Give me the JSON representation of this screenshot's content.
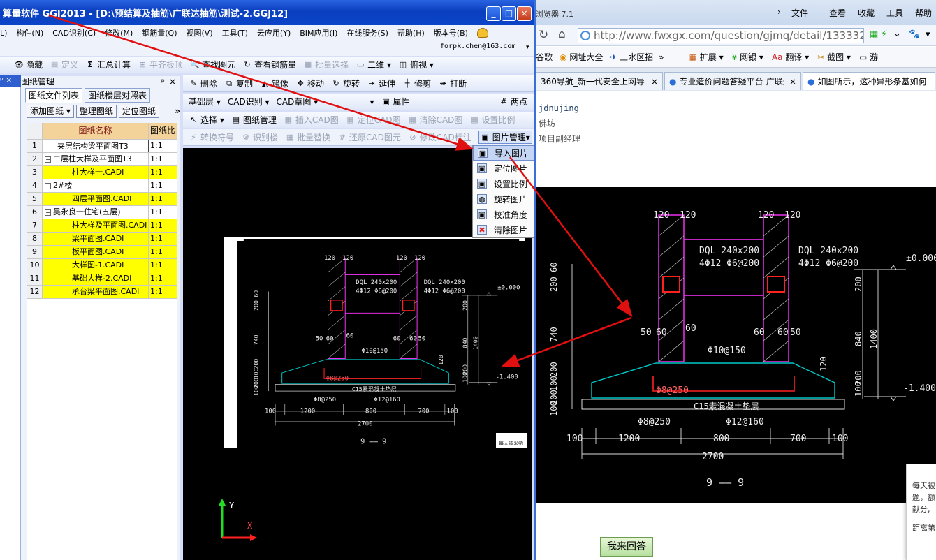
{
  "app": {
    "title": "算量软件 GGJ2013 - [D:\\预结算及抽筋\\广联达抽筋\\测试-2.GGJ12]",
    "window_buttons": {
      "minimize": "_",
      "maximize": "□",
      "close": "×"
    },
    "menu": [
      "L)",
      "构件(N)",
      "CAD识别(C)",
      "修改(M)",
      "钢筋量(Q)",
      "视图(V)",
      "工具(T)",
      "云应用(Y)",
      "BIM应用(I)",
      "在线服务(S)",
      "帮助(H)",
      "版本号(B)"
    ],
    "email": "forpk.chen@163.com",
    "toolbar1": [
      {
        "label": "隐藏",
        "icon": "eye-icon",
        "enabled": true
      },
      {
        "label": "定义",
        "icon": "define-icon",
        "enabled": false
      },
      {
        "label": "汇总计算",
        "icon": "sigma-icon",
        "enabled": true
      },
      {
        "label": "平齐板顶",
        "icon": "align-icon",
        "enabled": false
      },
      {
        "label": "查找图元",
        "icon": "find-icon",
        "enabled": true
      },
      {
        "label": "查看钢筋量",
        "icon": "view-rebar-icon",
        "enabled": true
      },
      {
        "label": "批量选择",
        "icon": "batch-select-icon",
        "enabled": false
      },
      {
        "label": "二维",
        "icon": "2d-icon",
        "enabled": true
      },
      {
        "label": "俯视",
        "icon": "top-view-icon",
        "enabled": true
      }
    ],
    "toolbar2": [
      {
        "label": "删除",
        "icon": "delete-icon"
      },
      {
        "label": "复制",
        "icon": "copy-icon"
      },
      {
        "label": "镜像",
        "icon": "mirror-icon"
      },
      {
        "label": "移动",
        "icon": "move-icon"
      },
      {
        "label": "旋转",
        "icon": "rotate-icon"
      },
      {
        "label": "延伸",
        "icon": "extend-icon"
      },
      {
        "label": "修剪",
        "icon": "trim-icon"
      },
      {
        "label": "打断",
        "icon": "break-icon"
      }
    ],
    "toolbar3": {
      "floor": "基础层",
      "cad_mode": "CAD识别",
      "cad_sub": "CAD草图",
      "properties": "属性",
      "two_point": "两点"
    },
    "toolbar4": [
      {
        "label": "选择",
        "enabled": true
      },
      {
        "label": "图纸管理",
        "enabled": true
      },
      {
        "label": "插入CAD图",
        "enabled": false
      },
      {
        "label": "定位CAD图",
        "enabled": false
      },
      {
        "label": "清除CAD图",
        "enabled": false
      },
      {
        "label": "设置比例",
        "enabled": false
      }
    ],
    "toolbar5": [
      {
        "label": "转换符号",
        "enabled": false
      },
      {
        "label": "识别楼",
        "enabled": false
      },
      {
        "label": "批量替换",
        "enabled": false
      },
      {
        "label": "还原CAD图元",
        "enabled": false
      },
      {
        "label": "修改CAD标注",
        "enabled": false
      },
      {
        "label": "图片管理",
        "enabled": true
      }
    ],
    "panel": {
      "title": "图纸管理",
      "pin": "ᵖ",
      "close": "×",
      "tabs": [
        "图纸文件列表",
        "图纸楼层对照表"
      ],
      "buttons": [
        "添加图纸",
        "整理图纸",
        "定位图纸"
      ],
      "more": "»",
      "columns": [
        "图纸名称",
        "图纸比"
      ],
      "rows": [
        {
          "n": "1",
          "name": "夹层结构梁平面图T3",
          "ratio": "1:1",
          "indent": 0,
          "toggle": "",
          "yellow": false
        },
        {
          "n": "2",
          "name": "二层柱大样及平面图T3",
          "ratio": "1:1",
          "indent": 0,
          "toggle": "−",
          "yellow": false
        },
        {
          "n": "3",
          "name": "柱大样一.CADI",
          "ratio": "1:1",
          "indent": 2,
          "toggle": "",
          "yellow": true
        },
        {
          "n": "4",
          "name": "2#楼",
          "ratio": "1:1",
          "indent": 0,
          "toggle": "−",
          "yellow": false
        },
        {
          "n": "5",
          "name": "四层平面图.CADI",
          "ratio": "1:1",
          "indent": 2,
          "toggle": "",
          "yellow": true
        },
        {
          "n": "6",
          "name": "吴永良一住宅(五层)",
          "ratio": "1:1",
          "indent": 0,
          "toggle": "−",
          "yellow": false
        },
        {
          "n": "7",
          "name": "柱大样及平面图.CADI",
          "ratio": "1:1",
          "indent": 2,
          "toggle": "",
          "yellow": true
        },
        {
          "n": "8",
          "name": "梁平面图.CADI",
          "ratio": "1:1",
          "indent": 2,
          "toggle": "",
          "yellow": true
        },
        {
          "n": "9",
          "name": "板平面图.CADI",
          "ratio": "1:1",
          "indent": 2,
          "toggle": "",
          "yellow": true
        },
        {
          "n": "10",
          "name": "大样图-1.CADI",
          "ratio": "1:1",
          "indent": 2,
          "toggle": "",
          "yellow": true
        },
        {
          "n": "11",
          "name": "基础大样-2.CADI",
          "ratio": "1:1",
          "indent": 2,
          "toggle": "",
          "yellow": true
        },
        {
          "n": "12",
          "name": "承台梁平面图.CADI",
          "ratio": "1:1",
          "indent": 2,
          "toggle": "",
          "yellow": true
        }
      ]
    },
    "popup_menu": [
      {
        "label": "导入图片",
        "icon": "import-image-icon",
        "selected": true
      },
      {
        "label": "定位图片",
        "icon": "locate-image-icon",
        "selected": false
      },
      {
        "label": "设置比例",
        "icon": "set-scale-icon",
        "selected": false
      },
      {
        "label": "旋转图片",
        "icon": "rotate-image-icon",
        "selected": false
      },
      {
        "label": "校准角度",
        "icon": "calibrate-angle-icon",
        "selected": false
      },
      {
        "label": "清除图片",
        "icon": "clear-image-icon",
        "selected": false
      }
    ],
    "canvas_overlay_text": "每天被采纳",
    "axis": {
      "x": "X",
      "y": "Y"
    }
  },
  "drawing": {
    "top_dims": [
      "120",
      "120"
    ],
    "dql": "DQL 240x200",
    "dql_rebar": "4Φ12 Φ6@200",
    "elev_top": "±0.000",
    "elev_bottom": "-1.400",
    "side_dims": [
      "200",
      "60",
      "740",
      "200",
      "100",
      "200",
      "100"
    ],
    "right_dims": [
      "200",
      "840",
      "1400",
      "120",
      "200",
      "100"
    ],
    "offsets": [
      "50",
      "60",
      "60",
      "60",
      "60",
      "50"
    ],
    "stirrup": "Φ10@150",
    "bottom_rebar": "Φ8@250",
    "pad": "C15素混凝土垫层",
    "pad_rebar_left": "Φ8@250",
    "pad_rebar_right": "Φ12@160",
    "bottom_dims": [
      "100",
      "1200",
      "800",
      "700",
      "100"
    ],
    "total": "2700",
    "section": "9 —— 9"
  },
  "browser": {
    "title": "浏览器 7.1",
    "menu": [
      "文件",
      "查看",
      "收藏",
      "工具",
      "帮助"
    ],
    "url": "http://www.fwxgx.com/question/gjmq/detail/1333322.htm",
    "favorites": [
      "谷歌",
      "网址大全",
      "三水区招",
      "扩展",
      "网银",
      "翻译",
      "截图",
      "游"
    ],
    "more": "»",
    "tabs": [
      {
        "label": "360导航_新一代安全上网导航",
        "active": false
      },
      {
        "label": "专业造价问题答疑平台-广联达",
        "active": false
      },
      {
        "label": "如图所示，这种异形条基如何",
        "active": true
      }
    ],
    "page_lines": [
      "jdnujing",
      "佛坊",
      "项目副经理"
    ],
    "answer_button": "我来回答",
    "side_popup": [
      "每天被",
      "题，额",
      "献分,",
      "距离第"
    ]
  },
  "colors": {
    "title_blue": "#0a3fbf",
    "grid_yellow": "#ffff00",
    "arrow_red": "#e01010",
    "cad_cyan": "#00c8c8",
    "cad_magenta": "#ff33ff",
    "cad_red": "#ff2020"
  }
}
